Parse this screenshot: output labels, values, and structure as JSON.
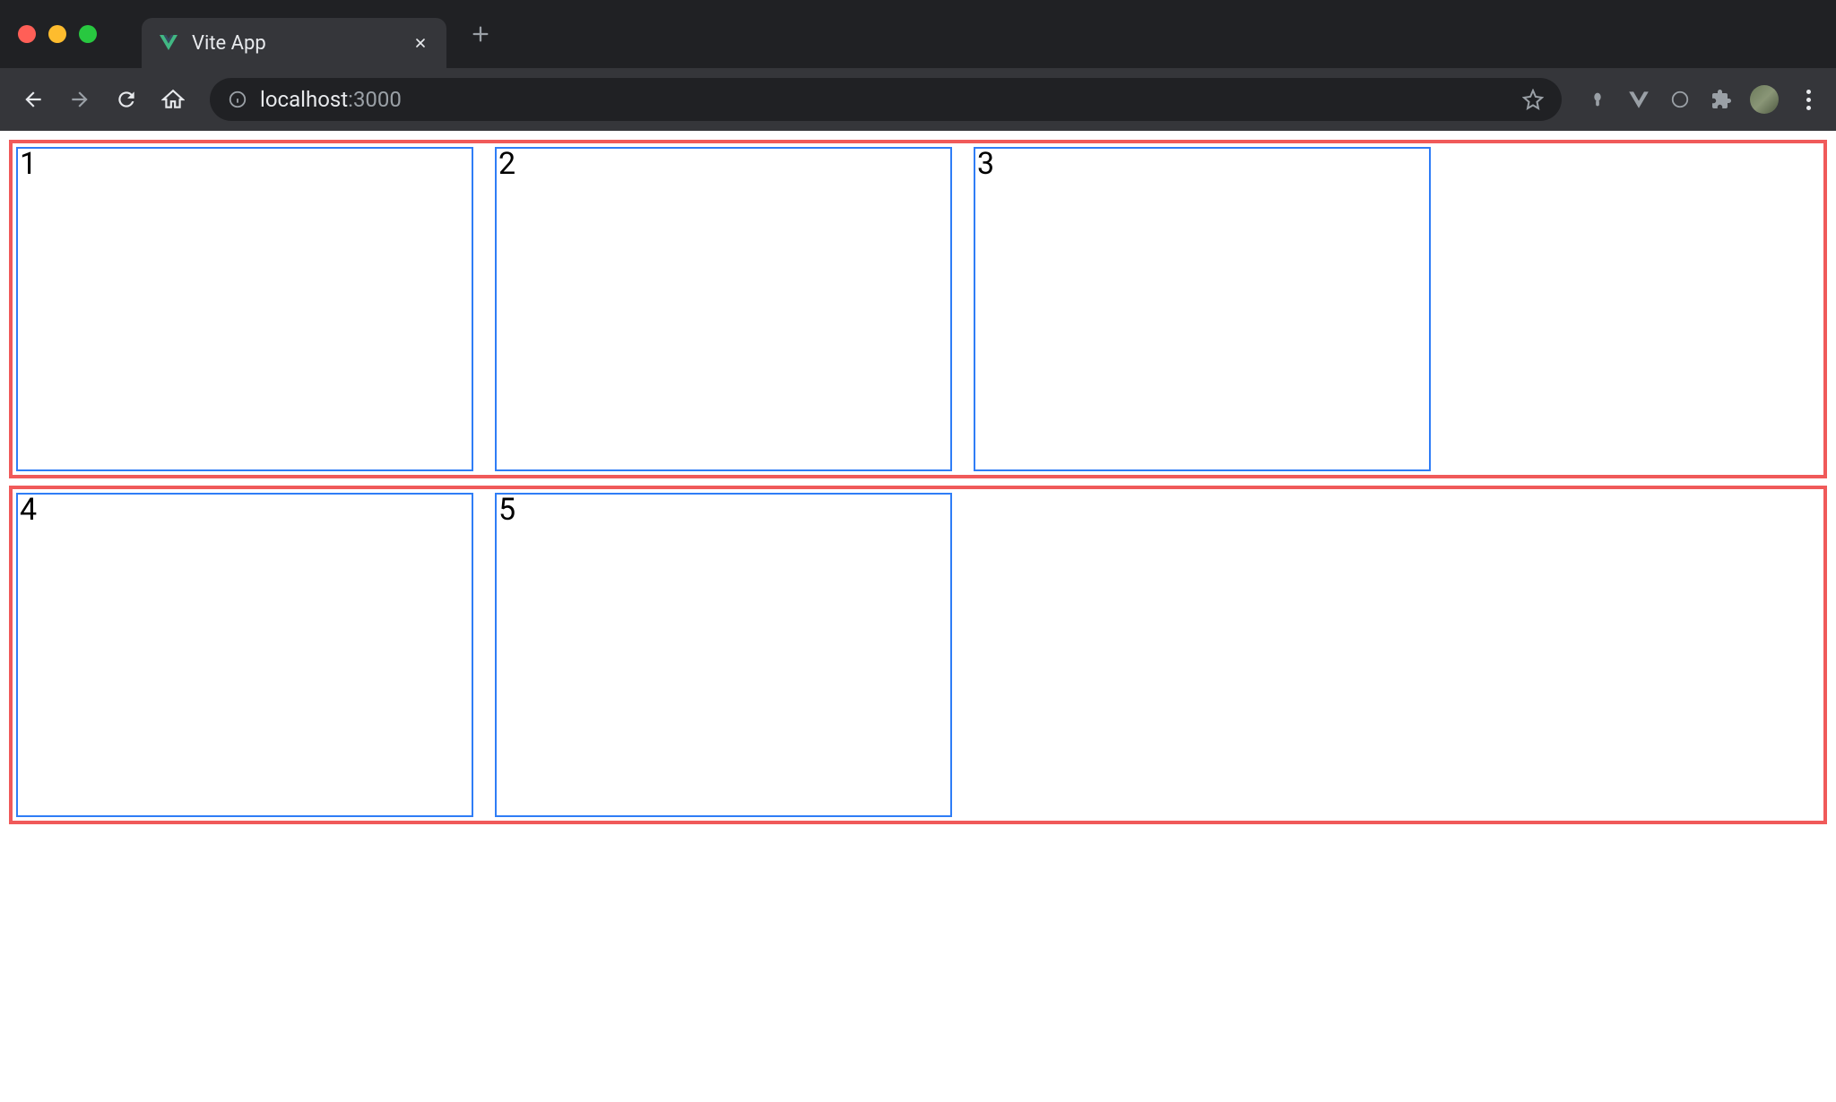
{
  "browser": {
    "tab": {
      "title": "Vite App",
      "favicon_name": "vue-logo-icon"
    },
    "url": {
      "host": "localhost",
      "port": ":3000"
    }
  },
  "page": {
    "rows": [
      {
        "boxes": [
          "1",
          "2",
          "3"
        ]
      },
      {
        "boxes": [
          "4",
          "5"
        ]
      }
    ]
  }
}
